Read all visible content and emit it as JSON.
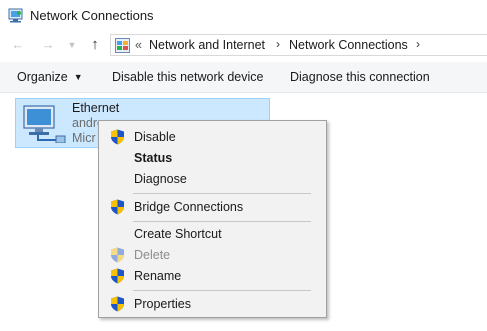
{
  "window": {
    "title": "Network Connections",
    "icon": "network-connections-icon"
  },
  "navigation": {
    "back_icon": "back-arrow-icon",
    "forward_icon": "forward-arrow-icon",
    "recent_icon": "chevron-down-icon",
    "up_icon": "up-arrow-icon",
    "address": {
      "overflow": "«",
      "crumbs": [
        "Network and Internet",
        "Network Connections"
      ],
      "separator": "›"
    }
  },
  "toolbar": {
    "organize_label": "Organize",
    "disable_label": "Disable this network device",
    "diagnose_label": "Diagnose this connection"
  },
  "selected_item": {
    "name": "Ethernet",
    "line2": "andro",
    "line3": "Micr"
  },
  "context_menu": {
    "items": [
      {
        "label": "Disable",
        "shield": true,
        "bold": false,
        "disabled": false
      },
      {
        "label": "Status",
        "shield": false,
        "bold": true,
        "disabled": false
      },
      {
        "label": "Diagnose",
        "shield": false,
        "bold": false,
        "disabled": false
      },
      {
        "label": "Bridge Connections",
        "shield": true,
        "bold": false,
        "disabled": false
      },
      {
        "label": "Create Shortcut",
        "shield": false,
        "bold": false,
        "disabled": false
      },
      {
        "label": "Delete",
        "shield": true,
        "bold": false,
        "disabled": true
      },
      {
        "label": "Rename",
        "shield": true,
        "bold": false,
        "disabled": false
      },
      {
        "label": "Properties",
        "shield": true,
        "bold": false,
        "disabled": false
      }
    ]
  },
  "colors": {
    "selection_fill": "#cce8ff",
    "selection_border": "#99d1ff",
    "menu_background": "#f2f2f2",
    "shield_blue": "#1e56c8",
    "shield_yellow": "#f7c000"
  }
}
